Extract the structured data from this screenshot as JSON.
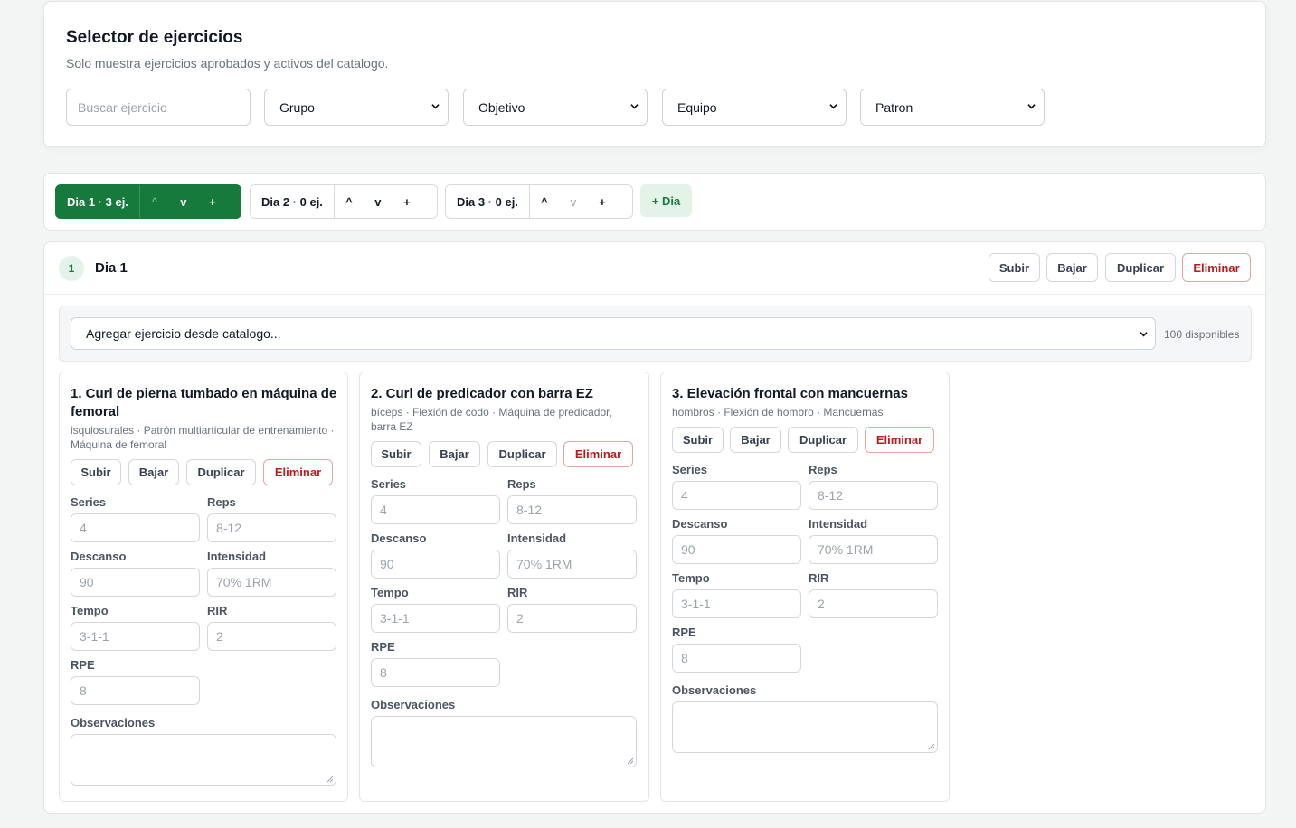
{
  "selector": {
    "title": "Selector de ejercicios",
    "subtitle": "Solo muestra ejercicios aprobados y activos del catalogo.",
    "search_placeholder": "Buscar ejercicio",
    "filters": [
      "Grupo",
      "Objetivo",
      "Equipo",
      "Patron"
    ]
  },
  "days_bar": {
    "days": [
      {
        "label": "Dia 1 · 3 ej.",
        "up": "^",
        "down": "v",
        "add": "+",
        "active": true
      },
      {
        "label": "Dia 2 · 0 ej.",
        "up": "^",
        "down": "v",
        "add": "+",
        "active": false
      },
      {
        "label": "Dia 3 · 0 ej.",
        "up": "^",
        "down": "v",
        "add": "+",
        "active": false
      }
    ],
    "add_day_label": "+ Dia"
  },
  "day_panel": {
    "number": "1",
    "name": "Dia 1",
    "actions": {
      "up": "Subir",
      "down": "Bajar",
      "duplicate": "Duplicar",
      "delete": "Eliminar"
    },
    "add_select_label": "Agregar ejercicio desde catalogo...",
    "available": "100 disponibles"
  },
  "labels": {
    "series": "Series",
    "reps": "Reps",
    "rest": "Descanso",
    "intensity": "Intensidad",
    "tempo": "Tempo",
    "rir": "RIR",
    "rpe": "RPE",
    "notes": "Observaciones"
  },
  "exercises": [
    {
      "name": "1. Curl de pierna tumbado en máquina de femoral",
      "meta": "isquiosurales · Patrón multiarticular de entrenamiento · Máquina de femoral",
      "actions": {
        "up": "Subir",
        "down": "Bajar",
        "duplicate": "Duplicar",
        "delete": "Eliminar"
      },
      "series": "4",
      "reps": "8-12",
      "rest": "90",
      "intensity": "70% 1RM",
      "tempo": "3-1-1",
      "rir": "2",
      "rpe": "8"
    },
    {
      "name": "2. Curl de predicador con barra EZ",
      "meta": "bíceps · Flexión de codo · Máquina de predicador, barra EZ",
      "actions": {
        "up": "Subir",
        "down": "Bajar",
        "duplicate": "Duplicar",
        "delete": "Eliminar"
      },
      "series": "4",
      "reps": "8-12",
      "rest": "90",
      "intensity": "70% 1RM",
      "tempo": "3-1-1",
      "rir": "2",
      "rpe": "8"
    },
    {
      "name": "3. Elevación frontal con mancuernas",
      "meta": "hombros · Flexión de hombro · Mancuernas",
      "actions": {
        "up": "Subir",
        "down": "Bajar",
        "duplicate": "Duplicar",
        "delete": "Eliminar"
      },
      "series": "4",
      "reps": "8-12",
      "rest": "90",
      "intensity": "70% 1RM",
      "tempo": "3-1-1",
      "rir": "2",
      "rpe": "8"
    }
  ]
}
